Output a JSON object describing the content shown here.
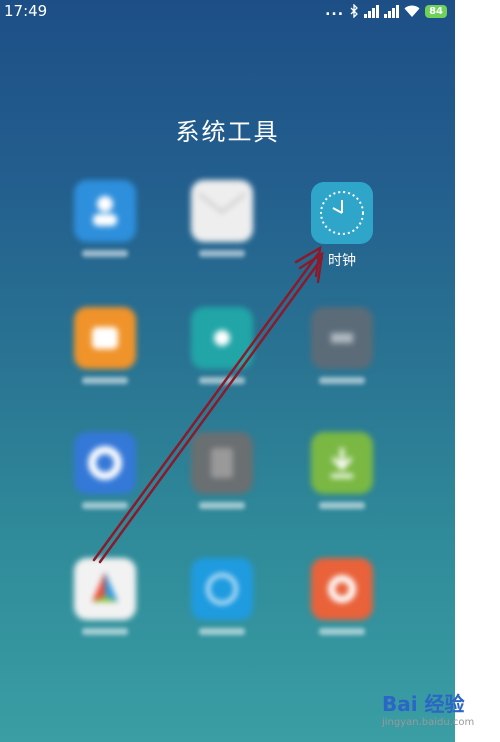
{
  "status_bar": {
    "time": "17:49",
    "more": "...",
    "battery": "84"
  },
  "folder": {
    "title": "系统工具"
  },
  "apps": [
    {
      "name": "contacts",
      "icon": "contacts-icon",
      "color": "#2e8fdc",
      "label": ""
    },
    {
      "name": "messages",
      "icon": "mail-icon",
      "color": "#eeeeee",
      "label": ""
    },
    {
      "name": "clock",
      "icon": "clock-icon",
      "color": "#2fa6c9",
      "label": "时钟"
    },
    {
      "name": "app-orange",
      "icon": "orange-app-icon",
      "color": "#f0932a",
      "label": ""
    },
    {
      "name": "app-teal",
      "icon": "teal-app-icon",
      "color": "#21a5a7",
      "label": ""
    },
    {
      "name": "app-gray",
      "icon": "gray-app-icon",
      "color": "#5b6c78",
      "label": ""
    },
    {
      "name": "app-blue-ring",
      "icon": "blue-ring-icon",
      "color": "#3478d8",
      "label": ""
    },
    {
      "name": "app-calculator",
      "icon": "calculator-icon",
      "color": "#6a6f72",
      "label": ""
    },
    {
      "name": "app-download",
      "icon": "download-icon",
      "color": "#7ab843",
      "label": ""
    },
    {
      "name": "app-colorful",
      "icon": "colorful-app-icon",
      "color": "#f2f2f2",
      "label": ""
    },
    {
      "name": "app-cyan",
      "icon": "cyan-app-icon",
      "color": "#1f9be0",
      "label": ""
    },
    {
      "name": "app-red",
      "icon": "red-app-icon",
      "color": "#e9623a",
      "label": ""
    }
  ],
  "watermark": {
    "main": "Bai 经验",
    "sub": "jingyan.baidu.com"
  },
  "colors": {
    "arrow": "#8b1a2b",
    "battery": "#6fd05a"
  }
}
